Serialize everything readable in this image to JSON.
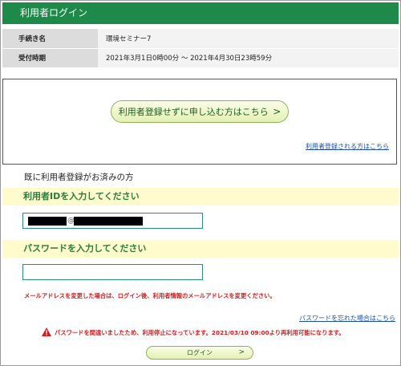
{
  "header": {
    "title": "利用者ログイン"
  },
  "info_table": [
    {
      "label": "手続き名",
      "value": "環境セミナー7"
    },
    {
      "label": "受付時期",
      "value": "2021年3月1日0時00分 ～ 2021年4月30日23時59分"
    }
  ],
  "guest": {
    "button_label": "利用者登録せずに申し込む方はこちら",
    "button_chevron": ">",
    "register_link": "利用者登録される方はこちら"
  },
  "existing": {
    "title": "既に利用者登録がお済みの方",
    "id_label": "利用者IDを入力してください",
    "id_value_visible": "@",
    "password_label": "パスワードを入力してください",
    "email_note": "メールアドレスを変更した場合は、ログイン後、利用者情報のメールアドレスを変更ください。",
    "forgot_link": "パスワードを忘れた場合はこちら",
    "lock_warning": "パスワードを間違いましたため、利用停止になっています。2021/03/10 09:00より再利用可能になります。",
    "login_label": "ログイン",
    "login_chevron": ">"
  },
  "colors": {
    "header_green": "#1d8a4a",
    "label_bar_bg": "#fffbcc",
    "label_text": "#2a7c3c",
    "warning_red": "#d41c1c",
    "link_blue": "#1d4fb0"
  },
  "icons": {
    "warning": "warning-triangle-icon"
  }
}
